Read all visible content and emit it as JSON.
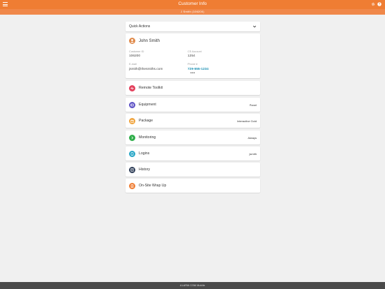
{
  "header": {
    "title": "Customer Info",
    "subtitle": "J Smith (106200)"
  },
  "quick_actions": {
    "label": "Quick Actions"
  },
  "customer": {
    "name": "John Smith",
    "customer_id_label": "Customer ID",
    "customer_id": "106200",
    "cs_account_label": "CS Account",
    "cs_account": "1254",
    "email_label": "E-mail",
    "email": "jsmith@thesmiths.com",
    "phone_label": "Phone #",
    "phone": "729-555-1234",
    "more": "•••"
  },
  "rows": [
    {
      "label": "Remote Toolkit",
      "value": "",
      "color": "#e3405c"
    },
    {
      "label": "Equipment",
      "value": "Panel",
      "color": "#5b4fc4"
    },
    {
      "label": "Package",
      "value": "Interactive Gold",
      "color": "#f0a33b"
    },
    {
      "label": "Monitoring",
      "value": "Always",
      "color": "#2fae4a"
    },
    {
      "label": "Logins",
      "value": "jsmith",
      "color": "#27a6c6"
    },
    {
      "label": "History",
      "value": "",
      "color": "#2b3a55"
    },
    {
      "label": "On-Site Wrap Up",
      "value": "",
      "color": "#ef7d33"
    }
  ],
  "footer": {
    "brand": "ALARM.COM Mobile"
  },
  "colors": {
    "primary": "#ef7d33",
    "background": "#f0f0f0",
    "footer": "#4a4a4a"
  }
}
